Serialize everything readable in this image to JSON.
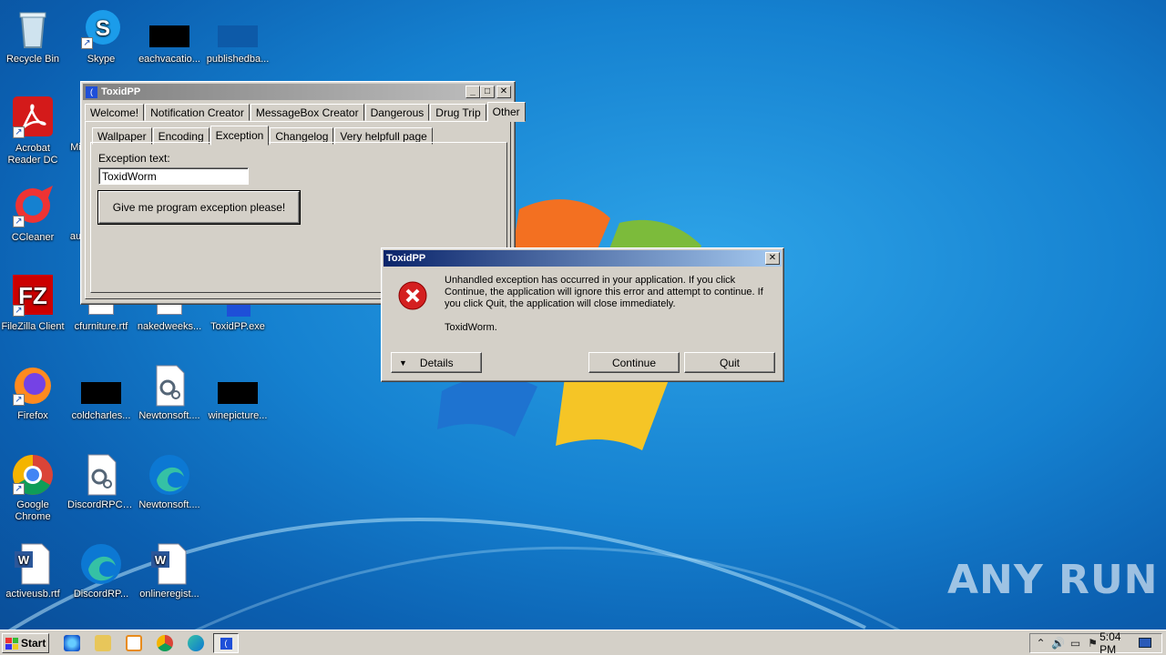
{
  "desktop": {
    "icons": [
      {
        "label": "Recycle Bin"
      },
      {
        "label": "Skype"
      },
      {
        "label": "eachvacatio..."
      },
      {
        "label": "publishedba..."
      },
      {
        "label": "Acrobat Reader DC"
      },
      {
        "label": "Mi"
      },
      {
        "label": "CCleaner"
      },
      {
        "label": "au"
      },
      {
        "label": "FileZilla Client"
      },
      {
        "label": "cfurniture.rtf"
      },
      {
        "label": "nakedweeks..."
      },
      {
        "label": "ToxidPP.exe"
      },
      {
        "label": "Firefox"
      },
      {
        "label": "coldcharles..."
      },
      {
        "label": "Newtonsoft...."
      },
      {
        "label": "winepicture..."
      },
      {
        "label": "Google Chrome"
      },
      {
        "label": "DiscordRPC.dll"
      },
      {
        "label": "Newtonsoft...."
      },
      {
        "label": "activeusb.rtf"
      },
      {
        "label": "DiscordRP..."
      },
      {
        "label": "onlineregist..."
      }
    ]
  },
  "main_window": {
    "title": "ToxidPP",
    "top_tabs": [
      "Welcome!",
      "Notification Creator",
      "MessageBox Creator",
      "Dangerous",
      "Drug Trip",
      "Other"
    ],
    "sub_tabs": [
      "Wallpaper",
      "Encoding",
      "Exception",
      "Changelog",
      "Very helpfull page"
    ],
    "exception_label": "Exception text:",
    "exception_value": "ToxidWorm",
    "exception_button": "Give me program exception please!"
  },
  "error_dialog": {
    "title": "ToxidPP",
    "message": "Unhandled exception has occurred in your application. If you click Continue, the application will ignore this error and attempt to continue. If you click Quit, the application will close immediately.",
    "detail": "ToxidWorm.",
    "details_button": "Details",
    "continue_button": "Continue",
    "quit_button": "Quit"
  },
  "taskbar": {
    "start_label": "Start",
    "clock": "5:04 PM"
  },
  "watermark": "ANY RUN"
}
